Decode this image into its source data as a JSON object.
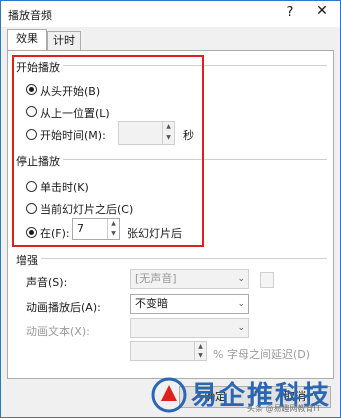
{
  "window": {
    "title": "播放音频",
    "help": "?",
    "close": "✕"
  },
  "tabs": [
    {
      "label": "效果",
      "active": true
    },
    {
      "label": "计时",
      "active": false
    }
  ],
  "start_play": {
    "heading": "开始播放",
    "options": [
      {
        "label": "从头开始(B)",
        "checked": true
      },
      {
        "label": "从上一位置(L)",
        "checked": false
      },
      {
        "label": "开始时间(M):",
        "checked": false
      }
    ],
    "time_value": "",
    "unit": "秒"
  },
  "stop_play": {
    "heading": "停止播放",
    "options": [
      {
        "label": "单击时(K)",
        "checked": false
      },
      {
        "label": "当前幻灯片之后(C)",
        "checked": false
      },
      {
        "label": "在(F):",
        "checked": true
      }
    ],
    "slide_count": "7",
    "slide_suffix": "张幻灯片后"
  },
  "enhance": {
    "heading": "增强",
    "sound_label": "声音(S):",
    "sound_value": "[无声音]",
    "after_anim_label": "动画播放后(A):",
    "after_anim_value": "不变暗",
    "anim_text_label": "动画文本(X):",
    "anim_text_value": "",
    "delay_value": "",
    "delay_suffix": "% 字母之间延迟(D)"
  },
  "buttons": {
    "ok": "确定",
    "cancel": "取消"
  },
  "watermark": {
    "text": "易企推科技",
    "sub": "头条 @易趣网教育IT"
  },
  "colors": {
    "highlight": "#e02020",
    "accent": "#2b79c9"
  }
}
